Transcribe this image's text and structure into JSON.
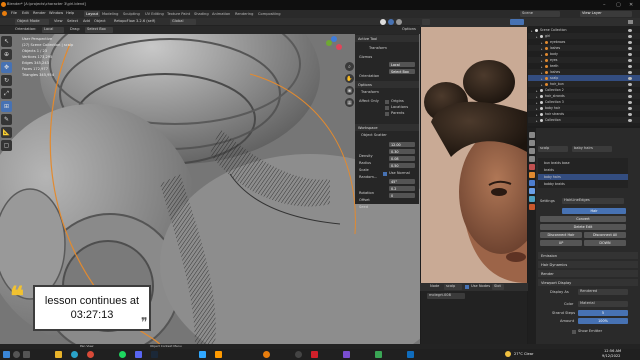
{
  "title_bar": {
    "text": "Blender* [A:\\projects\\character 3\\girl.blend]"
  },
  "menu": {
    "items": [
      "File",
      "Edit",
      "Render",
      "Window",
      "Help"
    ]
  },
  "workspaces": [
    "Layout",
    "Modeling",
    "Sculpting",
    "UV Editing",
    "Texture Paint",
    "Shading",
    "Animation",
    "Rendering",
    "Compositing"
  ],
  "active_workspace": "Layout",
  "scene_field": "Scene",
  "view_layer_field": "View Layer",
  "viewport_header": {
    "mode": "Object Mode",
    "view": "View",
    "select": "Select",
    "add": "Add",
    "object": "Object",
    "addon": "RetopoFlow 3.2.6 (self)",
    "orient": "Global"
  },
  "viewport_header2": {
    "orientation_label": "Orientation:",
    "orientation_value": "Local",
    "drag_label": "Drag:",
    "drag_value": "Select Box",
    "options": "Options"
  },
  "stats": {
    "perspective": "User Perspective",
    "collection": "(27) Scene Collection | scalp",
    "objects": "Objects   1 / 23",
    "vertices": "Vertices   173,295",
    "edges": "Edges   345,243",
    "faces": "Faces   172,977",
    "triangles": "Triangles   345,954"
  },
  "n_panel": {
    "active_tool": "Active Tool",
    "tool_name": "Transform",
    "gizmos": "Gizmos",
    "orientation_label": "Orientation",
    "orientation_value": "Local",
    "drag_label": "Drag",
    "drag_value": "Select Box",
    "options": "Options",
    "transform": "Transform",
    "affect_only": "Affect Only",
    "origins": "Origins",
    "locations": "Locations",
    "parents": "Parents",
    "workspace": "Workspace",
    "object_scatter": "Object Scatter",
    "density_label": "Density",
    "density_value": "12.00",
    "radius_label": "Radius",
    "radius_value": "0.30",
    "scale_label": "Scale",
    "scale_value": "0.08",
    "random_label": "Random...",
    "random_value": "0.50",
    "use_normal": "Use Normal",
    "rotation_label": "Rotation",
    "rotation_value": "45°",
    "offset_label": "Offset",
    "offset_value": "0.2",
    "seed_label": "Seed",
    "seed_value": "0"
  },
  "outliner": {
    "header": "Scene Collection",
    "rows": [
      {
        "name": "Scene Collection",
        "indent": 0,
        "sel": false
      },
      {
        "name": "girl",
        "indent": 1,
        "sel": false
      },
      {
        "name": "eyebrows",
        "indent": 2,
        "sel": false
      },
      {
        "name": "lashes",
        "indent": 2,
        "sel": false
      },
      {
        "name": "body",
        "indent": 2,
        "sel": false
      },
      {
        "name": "eyes",
        "indent": 2,
        "sel": false
      },
      {
        "name": "teeth",
        "indent": 2,
        "sel": false
      },
      {
        "name": "lashes",
        "indent": 2,
        "sel": false
      },
      {
        "name": "scalp",
        "indent": 2,
        "sel": true
      },
      {
        "name": "hair_bun",
        "indent": 2,
        "sel": false
      },
      {
        "name": "Collection 2",
        "indent": 1,
        "sel": false
      },
      {
        "name": "hair_strands",
        "indent": 1,
        "sel": false
      },
      {
        "name": "Collection 3",
        "indent": 1,
        "sel": false
      },
      {
        "name": "baby hair",
        "indent": 1,
        "sel": false
      },
      {
        "name": "hair strands",
        "indent": 1,
        "sel": false
      },
      {
        "name": "Collection",
        "indent": 1,
        "sel": false
      }
    ]
  },
  "properties": {
    "object": "scalp",
    "particle_system": "baby hairs",
    "list": [
      "bun braids base",
      "braids",
      "baby hairs",
      "bobby braids"
    ],
    "list_selected": 2,
    "settings": "HairLineEdges",
    "settings_label": "Settings",
    "hair_btn": "Hair",
    "convert_btn": "Convert",
    "delete_edit": "Delete Edit",
    "disconnect_hair": "Disconnect Hair",
    "disconnect_all": "Disconnect All",
    "up": "UP",
    "down": "DOWN",
    "emission": "Emission",
    "hair_dynamics": "Hair Dynamics",
    "render": "Render",
    "viewport_display": "Viewport Display",
    "display_as_label": "Display As",
    "display_as_value": "Rendered",
    "color_label": "Color",
    "color_value": "Material",
    "strand_steps_label": "Strand Steps",
    "strand_steps_value": "5",
    "amount_label": "Amount",
    "amount_value": "100%",
    "show_emitter": "Show Emitter"
  },
  "node_header": {
    "editor": "Node",
    "object": "scalp",
    "use_nodes": "Use Nodes",
    "slot": "Slot",
    "material": "mclegrt.008"
  },
  "statusbar": {
    "left": "Pan View",
    "mid": "Object Context Menu"
  },
  "taskbar": {
    "weather": "27°C  Clear",
    "time": "12:56 AM",
    "date": "9/12/2022"
  },
  "overlay": {
    "line1": "lesson continues at",
    "line2": "03:27:13"
  }
}
